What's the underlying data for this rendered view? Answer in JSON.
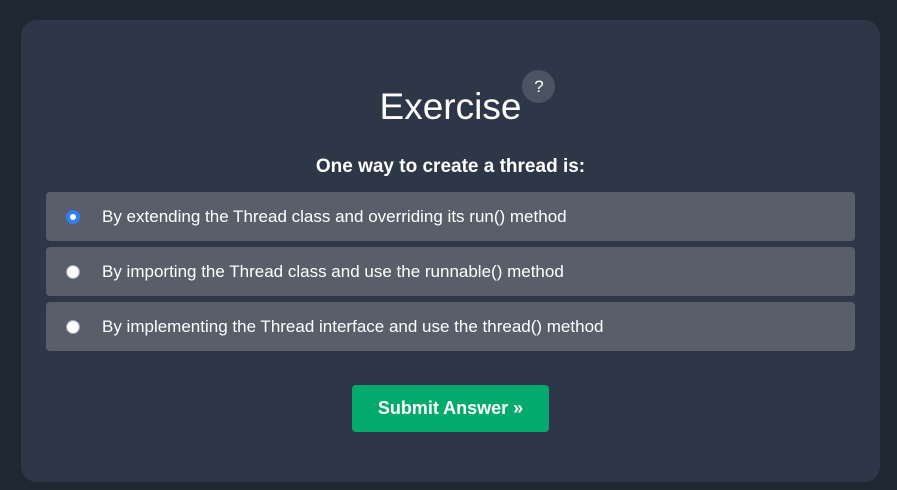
{
  "exercise": {
    "title": "Exercise",
    "help_label": "?",
    "question": "One way to create a thread is:",
    "options": [
      {
        "label": "By extending the Thread class and overriding its run() method",
        "selected": true
      },
      {
        "label": "By importing the Thread class and use the runnable() method",
        "selected": false
      },
      {
        "label": "By implementing the Thread interface and use the thread() method",
        "selected": false
      }
    ],
    "submit_label": "Submit Answer »"
  },
  "colors": {
    "page_background": "#1e2832",
    "panel_background": "#2d3748",
    "option_background": "#585f6b",
    "submit_background": "#04aa6d",
    "radio_selected": "#2f7ff5"
  }
}
